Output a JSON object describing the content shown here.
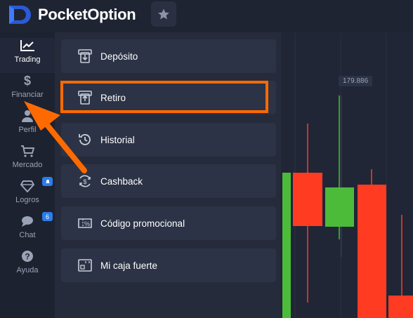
{
  "app": {
    "brand": "PocketOption",
    "brand_prefix": "Pocket",
    "brand_suffix": "Option"
  },
  "colors": {
    "accent": "#ff6a00",
    "badge": "#2b7de9",
    "bull": "#4cbb3a",
    "bear": "#ff3b22"
  },
  "sidebar": {
    "items": [
      {
        "label": "Trading",
        "icon": "chart-line-icon",
        "active": true
      },
      {
        "label": "Financiar",
        "icon": "dollar-icon"
      },
      {
        "label": "Perfil",
        "icon": "user-icon"
      },
      {
        "label": "Mercado",
        "icon": "cart-icon"
      },
      {
        "label": "Logros",
        "icon": "diamond-icon",
        "badge": ""
      },
      {
        "label": "Chat",
        "icon": "chat-icon",
        "badge": "6"
      },
      {
        "label": "Ayuda",
        "icon": "help-icon"
      }
    ]
  },
  "menu": {
    "items": [
      {
        "label": "Depósito",
        "icon": "deposit-icon"
      },
      {
        "label": "Retiro",
        "icon": "withdraw-icon",
        "highlighted": true
      },
      {
        "label": "Historial",
        "icon": "history-icon"
      },
      {
        "label": "Cashback",
        "icon": "cashback-icon"
      },
      {
        "label": "Código promocional",
        "icon": "promo-code-icon"
      },
      {
        "label": "Mi caja fuerte",
        "icon": "safe-icon"
      }
    ]
  },
  "chart": {
    "price_label": "179.886"
  }
}
